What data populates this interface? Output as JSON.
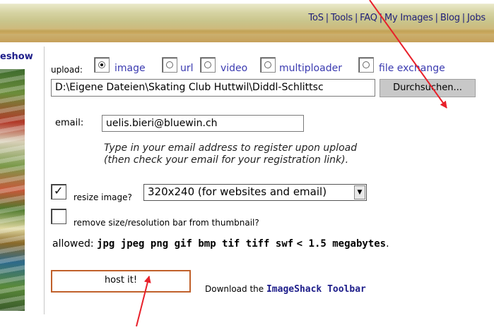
{
  "header": {
    "links": [
      "ToS",
      "Tools",
      "FAQ",
      "My Images",
      "Blog",
      "Jobs"
    ],
    "separator": "|"
  },
  "sidebar": {
    "title": "eshow"
  },
  "upload": {
    "label": "upload:",
    "options": [
      {
        "label": "image",
        "selected": true
      },
      {
        "label": "url",
        "selected": false
      },
      {
        "label": "video",
        "selected": false
      },
      {
        "label": "multiploader",
        "selected": false
      },
      {
        "label": "file exchange",
        "selected": false
      }
    ],
    "file_path": "D:\\Eigene Dateien\\Skating Club Huttwil\\Diddl-Schlittsc",
    "browse_label": "Durchsuchen..."
  },
  "email": {
    "label": "email:",
    "value": "uelis.bieri@bluewin.ch",
    "hint_line1": "Type in your email address to register upon upload",
    "hint_line2": "(then check your email for your registration link)."
  },
  "resize": {
    "label": "resize image?",
    "checked": true,
    "selected": "320x240 (for websites and email)"
  },
  "remove_bar": {
    "label": "remove size/resolution bar from thumbnail?",
    "checked": false
  },
  "allowed": {
    "label": "allowed:",
    "types": "jpg jpeg png gif bmp tif tiff swf",
    "limit": "< 1.5 megabytes",
    "end": "."
  },
  "host_button": "host it!",
  "toolbar": {
    "prefix": "Download the",
    "link": "ImageShack Toolbar"
  },
  "colors": {
    "annotation_arrow": "#e8202a",
    "link_blue": "#1e1e8a",
    "button_border": "#c0602a"
  }
}
